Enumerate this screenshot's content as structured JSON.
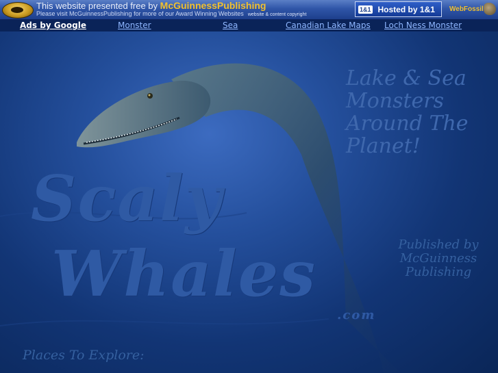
{
  "banner": {
    "line1_prefix": "This website presented free by ",
    "line1_brand": "McGuinnessPublishing",
    "line2": "Please visit McGuinnessPublishing for more of our Award Winning Websites",
    "line2_small": "website & content copyright",
    "hosted_badge": "1&1",
    "hosted_label": "Hosted by 1&1",
    "webfossil_label": "WebFossil"
  },
  "linkbar": {
    "ads": "Ads by Google",
    "links": [
      "Monster",
      "Sea",
      "Canadian Lake Maps",
      "Loch Ness Monster"
    ]
  },
  "art": {
    "brand_line1": "Scaly",
    "brand_line2": "Whales",
    "brand_suffix": ".com",
    "tagline": "Lake & Sea Monsters Around The Planet!",
    "published": "Published by McGuinness Publishing",
    "places": "Places To Explore:"
  },
  "colors": {
    "background": "#0a2a66",
    "link": "#8fb7ff",
    "brand_gold": "#f2c12e"
  }
}
